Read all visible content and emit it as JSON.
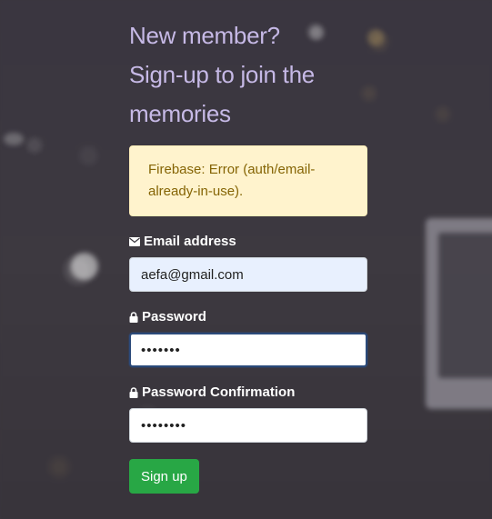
{
  "heading": {
    "line1": "New member?",
    "line2": "Sign-up to join the",
    "line3": "memories"
  },
  "alert": {
    "text": "Firebase: Error (auth/email-already-in-use)."
  },
  "email": {
    "label": "Email address",
    "icon": "envelope-icon",
    "value": "aefa@gmail.com"
  },
  "password": {
    "label": "Password",
    "icon": "lock-icon",
    "value": "1234567"
  },
  "password_confirmation": {
    "label": "Password Confirmation",
    "icon": "lock-icon",
    "value": "12345678"
  },
  "submit": {
    "label": "Sign up"
  },
  "colors": {
    "heading": "#c6b9e6",
    "alert_bg": "#fff3cd",
    "alert_text": "#856404",
    "button": "#28a745",
    "background": "#3b373e"
  }
}
